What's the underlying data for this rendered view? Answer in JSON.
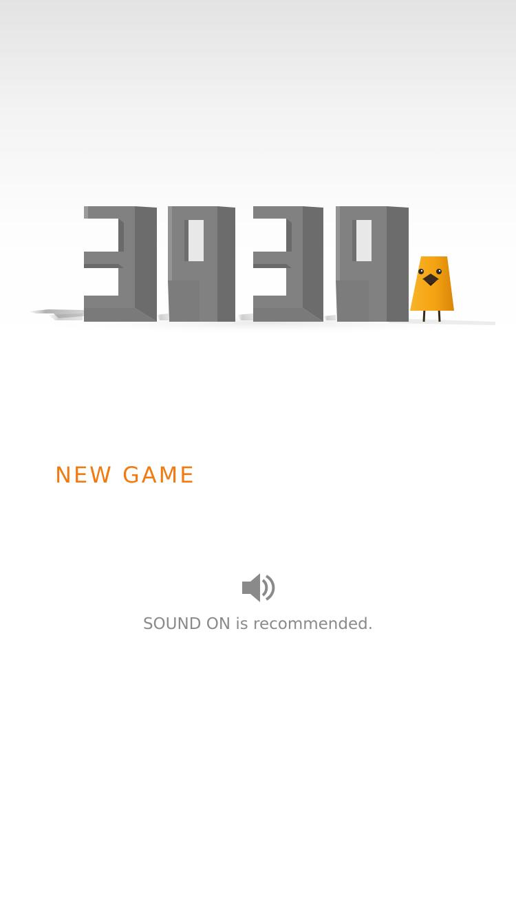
{
  "title_logo": {
    "text": "3939"
  },
  "menu": {
    "new_game_label": "NEW GAME"
  },
  "sound": {
    "icon": "speaker-icon",
    "note": "SOUND ON is recommended."
  },
  "colors": {
    "accent": "#f07b12",
    "logo_block": "#808080",
    "mascot": "#f5a312",
    "note_text": "#8a8a8a"
  }
}
